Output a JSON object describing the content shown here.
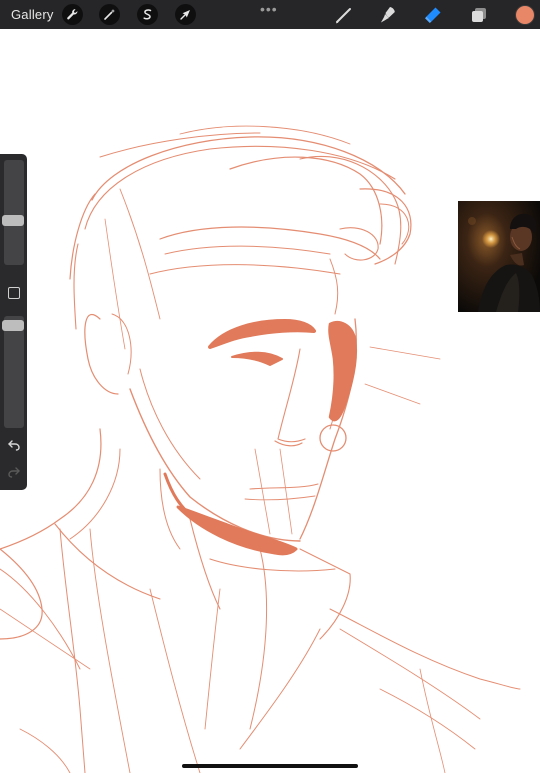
{
  "toolbar": {
    "gallery_label": "Gallery",
    "left_tools": [
      {
        "icon": "wrench-icon"
      },
      {
        "icon": "magic-wand-icon"
      },
      {
        "icon": "selection-s-icon"
      },
      {
        "icon": "transform-arrow-icon"
      }
    ],
    "more_dots": "•••",
    "right_tools": [
      {
        "icon": "brush-icon"
      },
      {
        "icon": "smudge-icon"
      },
      {
        "icon": "eraser-icon",
        "active": true
      },
      {
        "icon": "layers-icon"
      }
    ],
    "active_color": "#e88668",
    "active_tool_color": "#1e8cff"
  },
  "sidebar": {
    "brush_size_level": 0.62,
    "opacity_level": 0.05,
    "undo_icon": "undo-arrow-icon",
    "redo_icon": "redo-arrow-icon"
  },
  "canvas": {
    "stroke_color": "#e07a5a",
    "subject": "sketch-portrait"
  },
  "reference": {
    "image": "reference-photo"
  }
}
